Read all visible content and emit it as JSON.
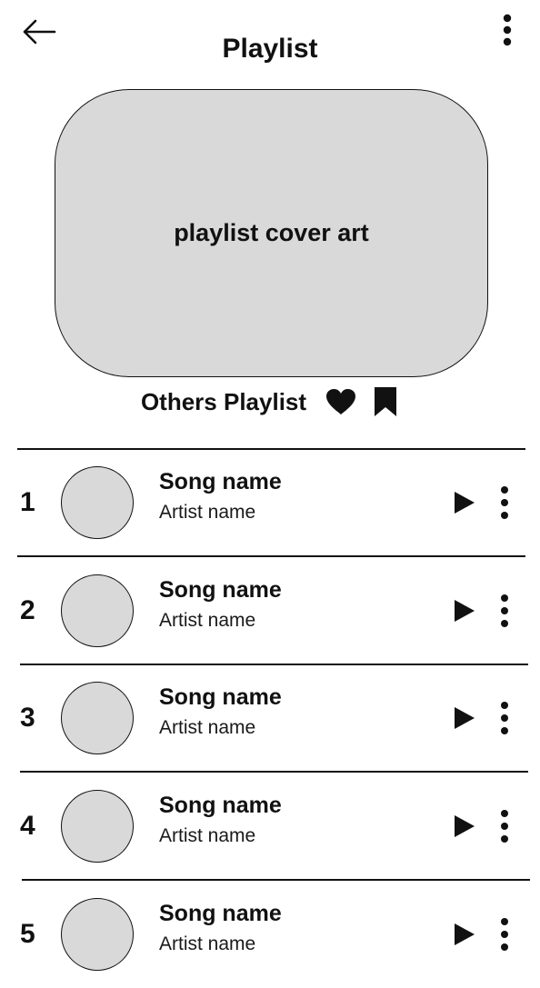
{
  "header": {
    "title": "Playlist",
    "back_icon": "arrow-left-icon",
    "menu_icon": "more-vertical-icon"
  },
  "cover": {
    "label": "playlist cover art",
    "color": "#d9d9d9"
  },
  "owner": {
    "name": "Others Playlist",
    "like_icon": "heart-icon",
    "save_icon": "bookmark-icon"
  },
  "tracks": [
    {
      "number": "1",
      "song": "Song name",
      "artist": "Artist name"
    },
    {
      "number": "2",
      "song": "Song name",
      "artist": "Artist name"
    },
    {
      "number": "3",
      "song": "Song name",
      "artist": "Artist name"
    },
    {
      "number": "4",
      "song": "Song name",
      "artist": "Artist name"
    },
    {
      "number": "5",
      "song": "Song name",
      "artist": "Artist name"
    }
  ],
  "track_icons": {
    "play": "play-icon",
    "more": "more-vertical-icon"
  }
}
